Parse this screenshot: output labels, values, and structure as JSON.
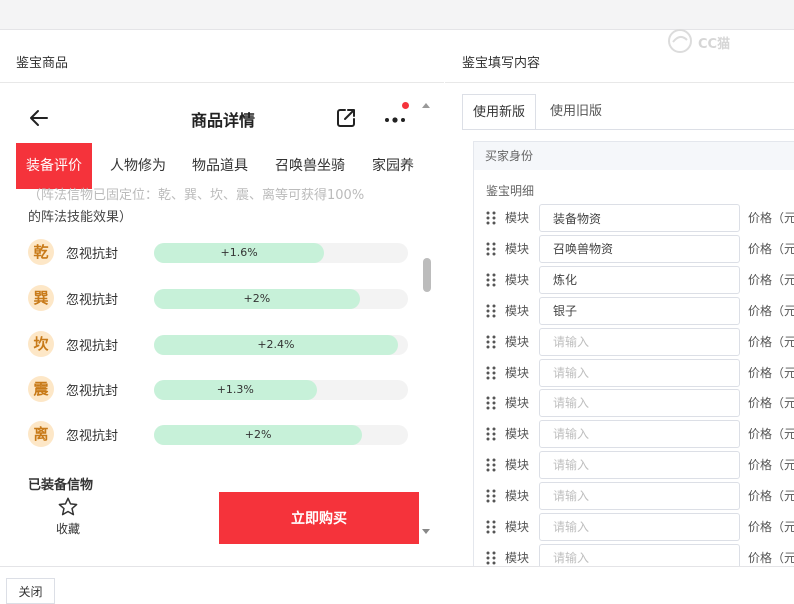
{
  "left_section": {
    "title": "鉴宝商品"
  },
  "right_section": {
    "title": "鉴宝填写内容"
  },
  "phone": {
    "title": "商品详情",
    "tabs": [
      "装备评价",
      "人物修为",
      "物品道具",
      "召唤兽坐骑",
      "家园养"
    ],
    "active_tab": 0,
    "faded_text": "（阵法信物已固定位：乾、巽、坎、震、离等可获得100%",
    "desc_line2": "的阵法技能效果）",
    "skills": [
      {
        "trigram": "乾",
        "name": "忽视抗封",
        "value": "+1.6%",
        "fill_pct": 67
      },
      {
        "trigram": "巽",
        "name": "忽视抗封",
        "value": "+2%",
        "fill_pct": 81
      },
      {
        "trigram": "坎",
        "name": "忽视抗封",
        "value": "+2.4%",
        "fill_pct": 96
      },
      {
        "trigram": "震",
        "name": "忽视抗封",
        "value": "+1.3%",
        "fill_pct": 64
      },
      {
        "trigram": "离",
        "name": "忽视抗封",
        "value": "+2%",
        "fill_pct": 82
      }
    ],
    "equip_title": "已装备信物",
    "fav_label": "收藏",
    "buy_label": "立即购买"
  },
  "form": {
    "tabs": [
      "使用新版",
      "使用旧版"
    ],
    "active_tab": 0,
    "buyer_label": "买家身份",
    "detail_label": "鉴宝明细",
    "module_label": "模块",
    "price_label": "价格（元",
    "placeholder": "请输入",
    "modules": [
      "装备物资",
      "召唤兽物资",
      "炼化",
      "银子",
      "",
      "",
      "",
      "",
      "",
      "",
      "",
      ""
    ]
  },
  "footer": {
    "close_label": "关闭"
  },
  "watermark": {
    "text": "CC猫"
  }
}
